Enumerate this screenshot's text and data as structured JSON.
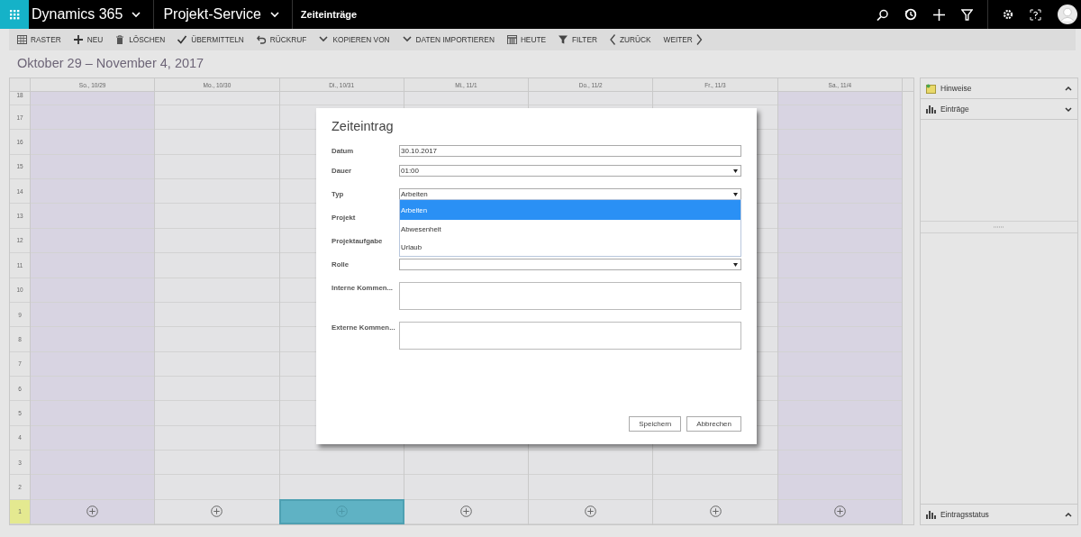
{
  "app_bar": {
    "app_name": "Dynamics 365",
    "area": "Projekt-Service",
    "page": "Zeiteinträge"
  },
  "toolbar": [
    {
      "label": "RASTER"
    },
    {
      "label": "NEU"
    },
    {
      "label": "LÖSCHEN"
    },
    {
      "label": "ÜBERMITTELN"
    },
    {
      "label": "RÜCKRUF"
    },
    {
      "label": "KOPIEREN VON"
    },
    {
      "label": "DATEN IMPORTIEREN"
    },
    {
      "label": "HEUTE"
    },
    {
      "label": "FILTER"
    },
    {
      "label": "ZURÜCK"
    },
    {
      "label": "WEITER"
    }
  ],
  "date_range": "Oktober 29 – November 4, 2017",
  "calendar": {
    "days": [
      {
        "label": "So., 10/29",
        "weekend": true,
        "selected": false
      },
      {
        "label": "Mo., 10/30",
        "weekend": false,
        "selected": false
      },
      {
        "label": "Di., 10/31",
        "weekend": false,
        "selected": true
      },
      {
        "label": "Mi., 11/1",
        "weekend": false,
        "selected": false
      },
      {
        "label": "Do., 11/2",
        "weekend": false,
        "selected": false
      },
      {
        "label": "Fr., 11/3",
        "weekend": false,
        "selected": false
      },
      {
        "label": "Sa., 11/4",
        "weekend": true,
        "selected": false
      }
    ],
    "hours": [
      {
        "label": "18",
        "current": false
      },
      {
        "label": "17",
        "current": false
      },
      {
        "label": "16",
        "current": false
      },
      {
        "label": "15",
        "current": false
      },
      {
        "label": "14",
        "current": false
      },
      {
        "label": "13",
        "current": false
      },
      {
        "label": "12",
        "current": false
      },
      {
        "label": "11",
        "current": false
      },
      {
        "label": "10",
        "current": false
      },
      {
        "label": "9",
        "current": false
      },
      {
        "label": "8",
        "current": false
      },
      {
        "label": "7",
        "current": false
      },
      {
        "label": "6",
        "current": false
      },
      {
        "label": "5",
        "current": false
      },
      {
        "label": "4",
        "current": false
      },
      {
        "label": "3",
        "current": false
      },
      {
        "label": "2",
        "current": false
      },
      {
        "label": "1",
        "current": true
      }
    ]
  },
  "side_panel": {
    "sections": [
      {
        "title": "Hinweise",
        "expanded": true
      },
      {
        "title": "Einträge",
        "expanded": false
      },
      {
        "title": "Eintragsstatus",
        "expanded": true
      }
    ]
  },
  "dialog": {
    "title": "Zeiteintrag",
    "fields": [
      {
        "label": "Datum",
        "kind": "text",
        "value": "30.10.2017"
      },
      {
        "label": "Dauer",
        "kind": "select",
        "value": "01:00"
      },
      {
        "label": "Typ",
        "kind": "select",
        "value": "Arbeiten",
        "options": [
          {
            "label": "Arbeiten",
            "selected": true
          },
          {
            "label": "Abwesenheit",
            "selected": false
          },
          {
            "label": "Urlaub",
            "selected": false
          }
        ]
      },
      {
        "label": "Projekt",
        "kind": "covered"
      },
      {
        "label": "Projektaufgabe",
        "kind": "covered"
      },
      {
        "label": "Rolle",
        "kind": "select"
      },
      {
        "label": "Interne Kommen...",
        "kind": "textarea"
      },
      {
        "label": "Externe Kommen...",
        "kind": "textarea"
      }
    ],
    "buttons": [
      "Speichern",
      "Abbrechen"
    ]
  }
}
